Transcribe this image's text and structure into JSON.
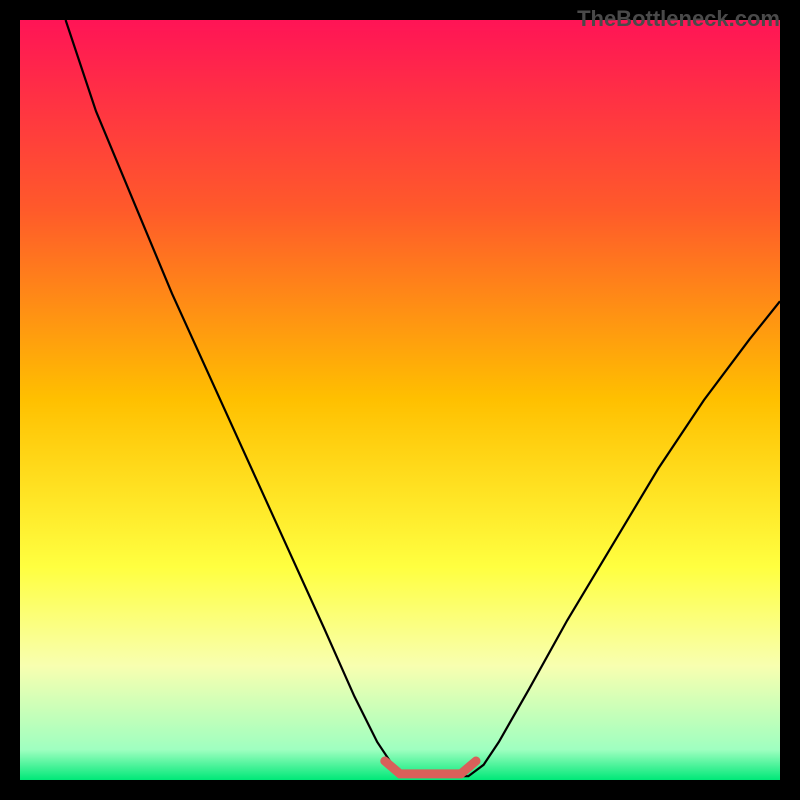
{
  "watermark": "TheBottleneck.com",
  "chart_data": {
    "type": "line",
    "title": "",
    "xlabel": "",
    "ylabel": "",
    "xlim": [
      0,
      100
    ],
    "ylim": [
      0,
      100
    ],
    "gradient_stops": [
      {
        "offset": 0,
        "color": "#ff1456"
      },
      {
        "offset": 25,
        "color": "#ff5a2a"
      },
      {
        "offset": 50,
        "color": "#ffc000"
      },
      {
        "offset": 72,
        "color": "#ffff40"
      },
      {
        "offset": 85,
        "color": "#f8ffb0"
      },
      {
        "offset": 96,
        "color": "#9fffc0"
      },
      {
        "offset": 100,
        "color": "#00e878"
      }
    ],
    "series": [
      {
        "name": "bottleneck-curve",
        "color": "#000000",
        "points": [
          {
            "x": 6,
            "y": 100
          },
          {
            "x": 10,
            "y": 88
          },
          {
            "x": 15,
            "y": 76
          },
          {
            "x": 20,
            "y": 64
          },
          {
            "x": 25,
            "y": 53
          },
          {
            "x": 30,
            "y": 42
          },
          {
            "x": 35,
            "y": 31
          },
          {
            "x": 40,
            "y": 20
          },
          {
            "x": 44,
            "y": 11
          },
          {
            "x": 47,
            "y": 5
          },
          {
            "x": 49,
            "y": 2
          },
          {
            "x": 51,
            "y": 0.5
          },
          {
            "x": 55,
            "y": 0.5
          },
          {
            "x": 59,
            "y": 0.5
          },
          {
            "x": 61,
            "y": 2
          },
          {
            "x": 63,
            "y": 5
          },
          {
            "x": 67,
            "y": 12
          },
          {
            "x": 72,
            "y": 21
          },
          {
            "x": 78,
            "y": 31
          },
          {
            "x": 84,
            "y": 41
          },
          {
            "x": 90,
            "y": 50
          },
          {
            "x": 96,
            "y": 58
          },
          {
            "x": 100,
            "y": 63
          }
        ]
      },
      {
        "name": "optimal-zone",
        "color": "#d9605a",
        "stroke_width": 9,
        "points": [
          {
            "x": 48,
            "y": 2.5
          },
          {
            "x": 50,
            "y": 0.8
          },
          {
            "x": 54,
            "y": 0.8
          },
          {
            "x": 58,
            "y": 0.8
          },
          {
            "x": 60,
            "y": 2.5
          }
        ]
      }
    ]
  }
}
